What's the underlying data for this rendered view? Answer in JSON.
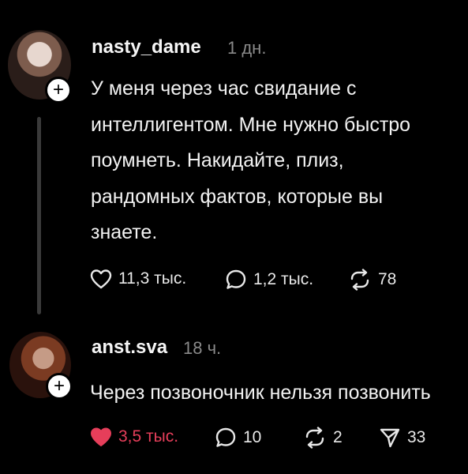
{
  "post": {
    "username": "nasty_dame",
    "time": "1 дн.",
    "text_lines": [
      "У меня через час свидание с",
      "интеллигентом. Мне нужно быстро",
      "поумнеть. Накидайте, плиз,",
      "рандомных фактов, которые вы",
      "знаете."
    ],
    "likes": "11,3 тыс.",
    "comments": "1,2 тыс.",
    "reposts": "78"
  },
  "reply": {
    "username": "anst.sva",
    "time": "18 ч.",
    "text": "Через позвоночник нельзя позвонить",
    "likes": "3,5 тыс.",
    "comments": "10",
    "reposts": "2",
    "shares": "33"
  },
  "colors": {
    "background": "#000000",
    "text": "#f2f2f2",
    "muted": "#8a8a8a",
    "like_active": "#e63e5a",
    "thread_line": "#3a3a3a"
  },
  "icons": [
    "plus-icon",
    "heart-icon",
    "comment-icon",
    "repost-icon",
    "send-icon"
  ]
}
